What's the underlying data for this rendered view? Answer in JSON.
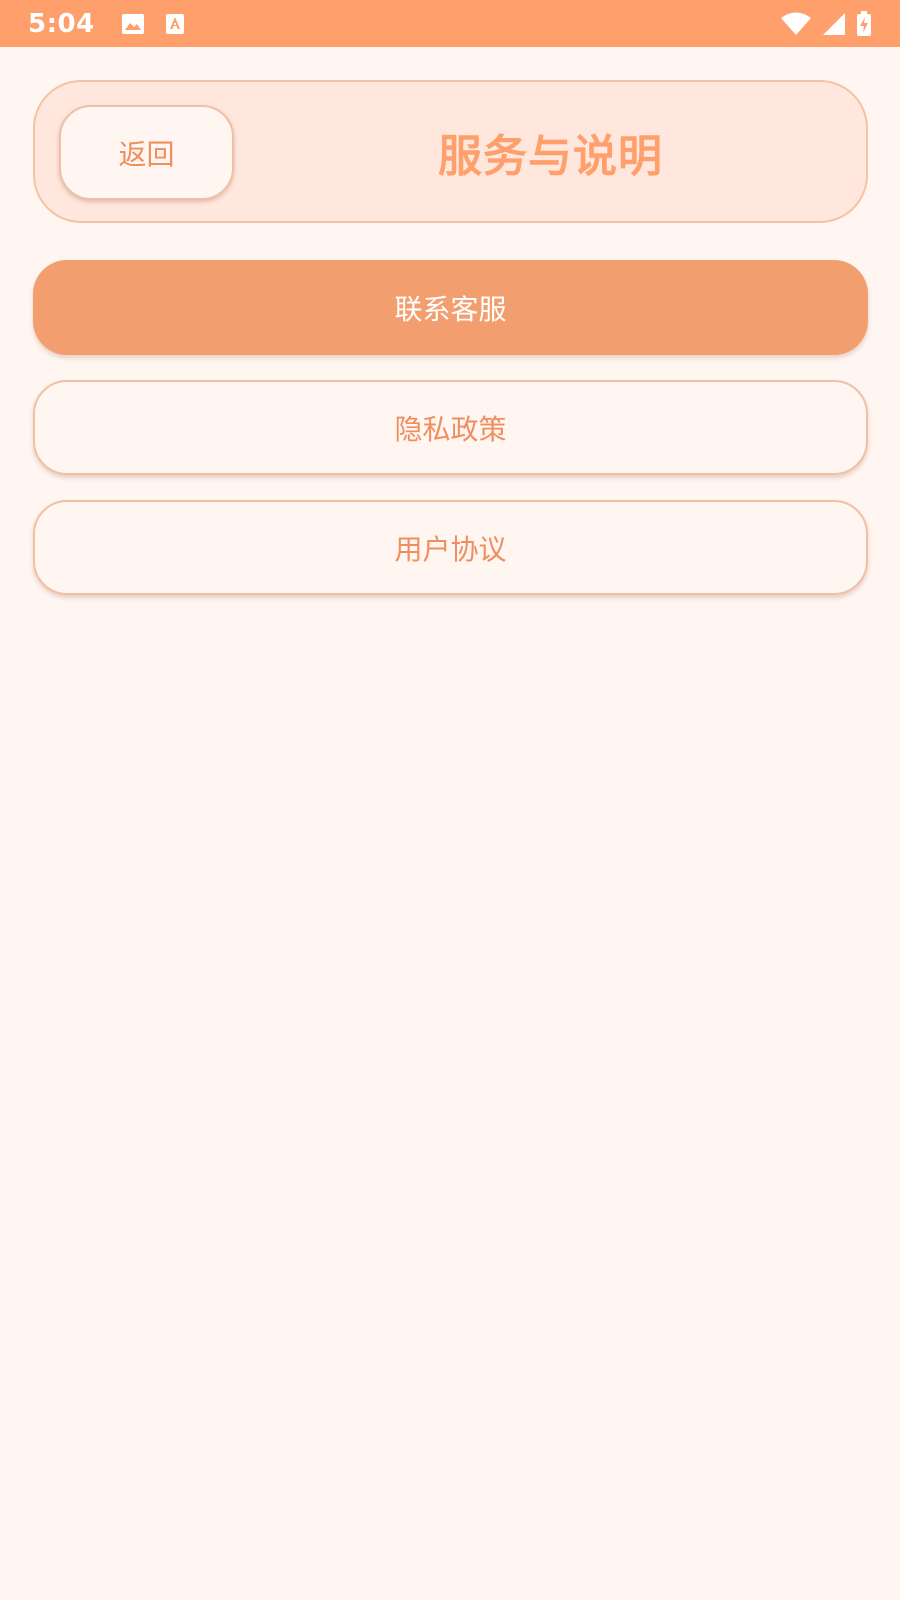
{
  "status_bar": {
    "time": "5:04",
    "icons": [
      "image-icon",
      "text-a-icon",
      "wifi-icon",
      "signal-icon",
      "battery-charging-icon"
    ]
  },
  "header": {
    "back_label": "返回",
    "title": "服务与说明"
  },
  "menu": {
    "contact_label": "联系客服",
    "privacy_label": "隐私政策",
    "agreement_label": "用户协议"
  },
  "colors": {
    "status_bar": "#ff9f6c",
    "background": "#fff6f2",
    "header_background": "#ffe7dd",
    "accent": "#f29e6e",
    "text_accent": "#f08e5f"
  }
}
